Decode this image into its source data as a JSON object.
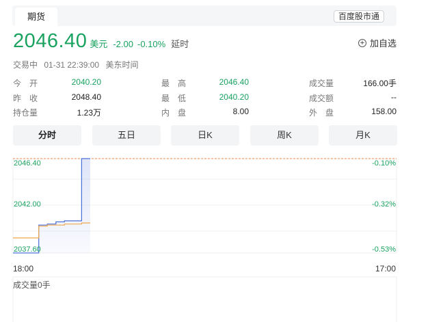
{
  "tabs": {
    "futures": "期货"
  },
  "brand": "百度股市通",
  "quote": {
    "price": "2046.40",
    "currency": "美元",
    "change": "-2.00",
    "change_pct": "-0.10%",
    "delay": "延时"
  },
  "watch_label": "加自选",
  "status": {
    "state": "交易中",
    "datetime": "01-31 22:39:00",
    "tz": "美东时间"
  },
  "stats": {
    "open_label": "今　开",
    "open": "2040.20",
    "prev_label": "昨　收",
    "prev": "2048.40",
    "oi_label": "持仓量",
    "oi": "1.23万",
    "high_label": "最　高",
    "high": "2046.40",
    "low_label": "最　低",
    "low": "2040.20",
    "inner_label": "内　盘",
    "inner": "8.00",
    "vol_label": "成交量",
    "vol": "166.00手",
    "amt_label": "成交额",
    "amt": "--",
    "outer_label": "外　盘",
    "outer": "158.00"
  },
  "periods": [
    "分时",
    "五日",
    "日K",
    "周K",
    "月K"
  ],
  "chart_data": {
    "type": "line",
    "y_ticks_left": [
      "2046.40",
      "2042.00",
      "2037.60"
    ],
    "y_ticks_right": [
      "-0.10%",
      "-0.32%",
      "-0.53%"
    ],
    "x_ticks": [
      "18:00",
      "17:00"
    ],
    "ylim": [
      2037.6,
      2046.4
    ],
    "reference_line": 2046.4,
    "series": [
      {
        "color": "#4a6fd6",
        "x": [
          0,
          1,
          2,
          3,
          4,
          5,
          6,
          7,
          8,
          9
        ],
        "values": [
          2037.6,
          2037.6,
          2037.6,
          2040.2,
          2040.3,
          2040.5,
          2040.6,
          2040.6,
          2046.4,
          2046.4
        ]
      },
      {
        "color": "#f0a84a",
        "x": [
          0,
          1,
          2,
          3,
          4,
          5,
          6,
          7,
          8,
          9
        ],
        "values": [
          2039.0,
          2039.0,
          2039.0,
          2040.1,
          2040.2,
          2040.2,
          2040.3,
          2040.3,
          2040.4,
          2040.4
        ]
      }
    ],
    "volume_label": "成交量0手"
  }
}
